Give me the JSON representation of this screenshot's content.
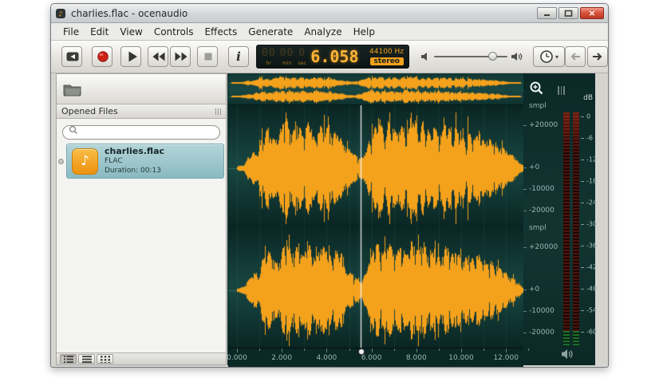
{
  "window": {
    "title": "charlies.flac - ocenaudio"
  },
  "menu": {
    "items": [
      "File",
      "Edit",
      "View",
      "Controls",
      "Effects",
      "Generate",
      "Analyze",
      "Help"
    ]
  },
  "toolbar": {
    "lcd": {
      "ghost_groups": [
        "00",
        "00",
        "0"
      ],
      "time": "6.058",
      "unit_labels": [
        "hr",
        "min",
        "sec"
      ],
      "sample_rate": "44100 Hz",
      "channel_mode": "stereo"
    }
  },
  "sidebar": {
    "header": "Opened Files",
    "file": {
      "name": "charlies.flac",
      "format": "FLAC",
      "duration": "Duration: 00:13"
    }
  },
  "wave": {
    "amp_labels": [
      "smpl",
      "+20000",
      "+0",
      "-10000",
      "-20000"
    ],
    "timeline_labels": [
      "0.000",
      "2.000",
      "4.000",
      "6.000",
      "8.000",
      "10.000",
      "12.000"
    ],
    "playhead_time_s": 5.52,
    "envelope": [
      [
        0,
        0.04
      ],
      [
        0.3,
        0.07
      ],
      [
        0.5,
        0.2
      ],
      [
        0.75,
        0.33
      ],
      [
        0.95,
        0.3
      ],
      [
        1.1,
        0.58
      ],
      [
        1.35,
        0.78
      ],
      [
        1.55,
        0.6
      ],
      [
        1.75,
        0.52
      ],
      [
        1.95,
        0.74
      ],
      [
        2.2,
        0.97
      ],
      [
        2.45,
        0.7
      ],
      [
        2.7,
        0.88
      ],
      [
        2.95,
        0.66
      ],
      [
        3.2,
        0.92
      ],
      [
        3.45,
        0.56
      ],
      [
        3.7,
        0.82
      ],
      [
        3.95,
        0.86
      ],
      [
        4.2,
        0.62
      ],
      [
        4.45,
        0.76
      ],
      [
        4.7,
        0.5
      ],
      [
        4.95,
        0.38
      ],
      [
        5.15,
        0.3
      ],
      [
        5.4,
        0.2
      ],
      [
        5.6,
        0.22
      ],
      [
        5.8,
        0.42
      ],
      [
        6.05,
        0.72
      ],
      [
        6.3,
        0.92
      ],
      [
        6.55,
        0.76
      ],
      [
        6.8,
        0.9
      ],
      [
        7.05,
        0.7
      ],
      [
        7.3,
        0.86
      ],
      [
        7.55,
        0.62
      ],
      [
        7.8,
        0.96
      ],
      [
        8.05,
        0.8
      ],
      [
        8.3,
        0.9
      ],
      [
        8.55,
        0.66
      ],
      [
        8.8,
        0.8
      ],
      [
        9.05,
        0.62
      ],
      [
        9.3,
        0.86
      ],
      [
        9.55,
        0.7
      ],
      [
        9.8,
        0.76
      ],
      [
        10.05,
        0.56
      ],
      [
        10.3,
        0.7
      ],
      [
        10.55,
        0.6
      ],
      [
        10.8,
        0.66
      ],
      [
        11.05,
        0.5
      ],
      [
        11.3,
        0.56
      ],
      [
        11.55,
        0.4
      ],
      [
        11.8,
        0.44
      ],
      [
        12.05,
        0.3
      ],
      [
        12.3,
        0.24
      ],
      [
        12.55,
        0.12
      ],
      [
        12.8,
        0.05
      ],
      [
        13.0,
        0.02
      ]
    ]
  },
  "meter": {
    "db": "dB",
    "scale": [
      "0",
      "-6",
      "-12",
      "-18",
      "-24",
      "-30",
      "-36",
      "-42",
      "-48",
      "-54",
      "-60"
    ]
  },
  "colors": {
    "accent_orange": "#f4a11c",
    "wave_bg": "#113431",
    "lcd_bg": "#0d1b19",
    "selection_teal": "#96c2c9",
    "record_red": "#cf2318"
  }
}
